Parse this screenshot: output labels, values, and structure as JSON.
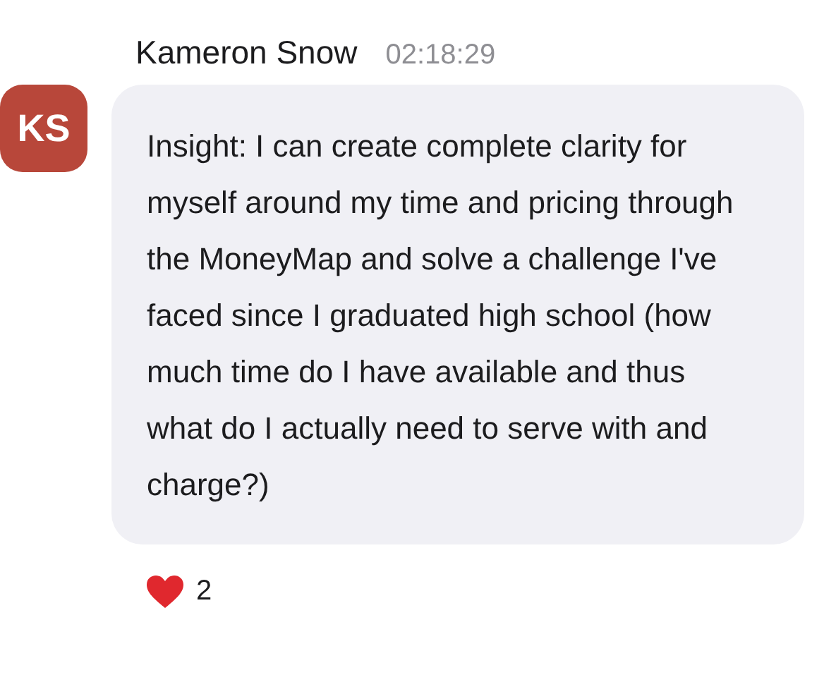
{
  "message": {
    "avatar_initials": "KS",
    "author": "Kameron Snow",
    "time": "02:18:29",
    "text": "Insight: I can create complete clarity for myself around my time and pricing through the MoneyMap and solve a challenge I've faced since I graduated high school (how much time do I have available and thus what do I actually need to serve with and charge?)",
    "reactions": [
      {
        "count": "2"
      }
    ]
  }
}
